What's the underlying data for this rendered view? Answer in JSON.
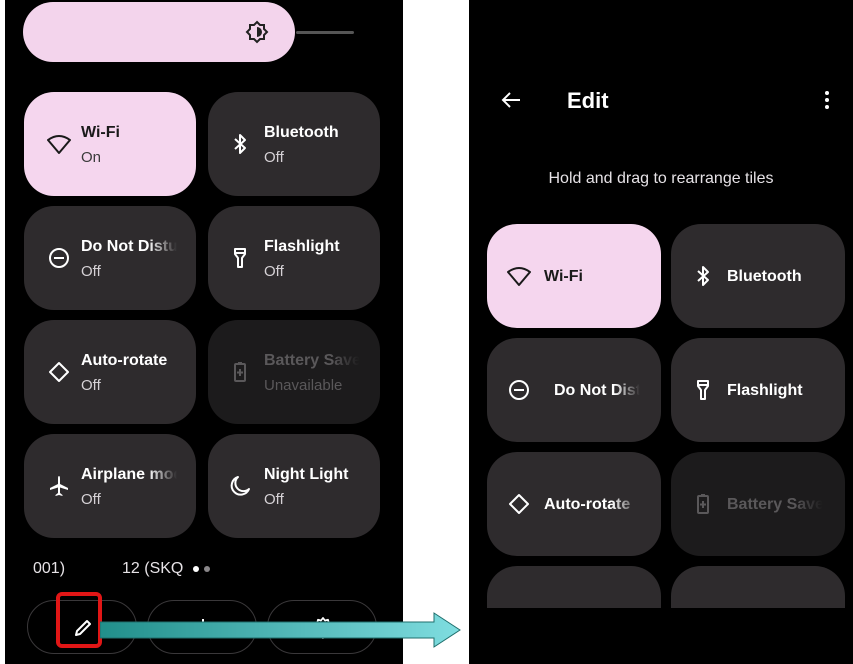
{
  "left_panel": {
    "tiles": [
      {
        "title": "Wi-Fi",
        "subtitle": "On",
        "icon": "wifi-icon"
      },
      {
        "title": "Bluetooth",
        "subtitle": "Off",
        "icon": "bluetooth-icon"
      },
      {
        "title": "Do Not Disturb",
        "subtitle": "Off",
        "icon": "do-not-disturb-icon"
      },
      {
        "title": "Flashlight",
        "subtitle": "Off",
        "icon": "flashlight-icon"
      },
      {
        "title": "Auto-rotate",
        "subtitle": "Off",
        "icon": "auto-rotate-icon"
      },
      {
        "title": "Battery Saver",
        "subtitle": "Unavailable",
        "icon": "battery-saver-icon"
      },
      {
        "title": "Airplane mode",
        "subtitle": "Off",
        "icon": "airplane-icon"
      },
      {
        "title": "Night Light",
        "subtitle": "Off",
        "icon": "night-light-icon"
      }
    ],
    "build_left": "001)",
    "build_right": "12 (SKQ",
    "bottom": {
      "edit": "pencil-icon",
      "power": "power-icon",
      "settings": "gear-icon"
    }
  },
  "right_panel": {
    "title": "Edit",
    "hint": "Hold and drag to rearrange tiles",
    "tiles": [
      {
        "title": "Wi-Fi",
        "icon": "wifi-icon"
      },
      {
        "title": "Bluetooth",
        "icon": "bluetooth-icon"
      },
      {
        "title": "Do Not Disturb",
        "icon": "do-not-disturb-icon"
      },
      {
        "title": "Flashlight",
        "icon": "flashlight-icon"
      },
      {
        "title": "Auto-rotate",
        "icon": "auto-rotate-icon"
      },
      {
        "title": "Battery Saver",
        "icon": "battery-saver-icon"
      }
    ]
  },
  "colors": {
    "active_tile": "#f5d6ee",
    "tile": "#2e2b2d",
    "highlight": "#e11616",
    "arrow": "#2a9c9a"
  }
}
